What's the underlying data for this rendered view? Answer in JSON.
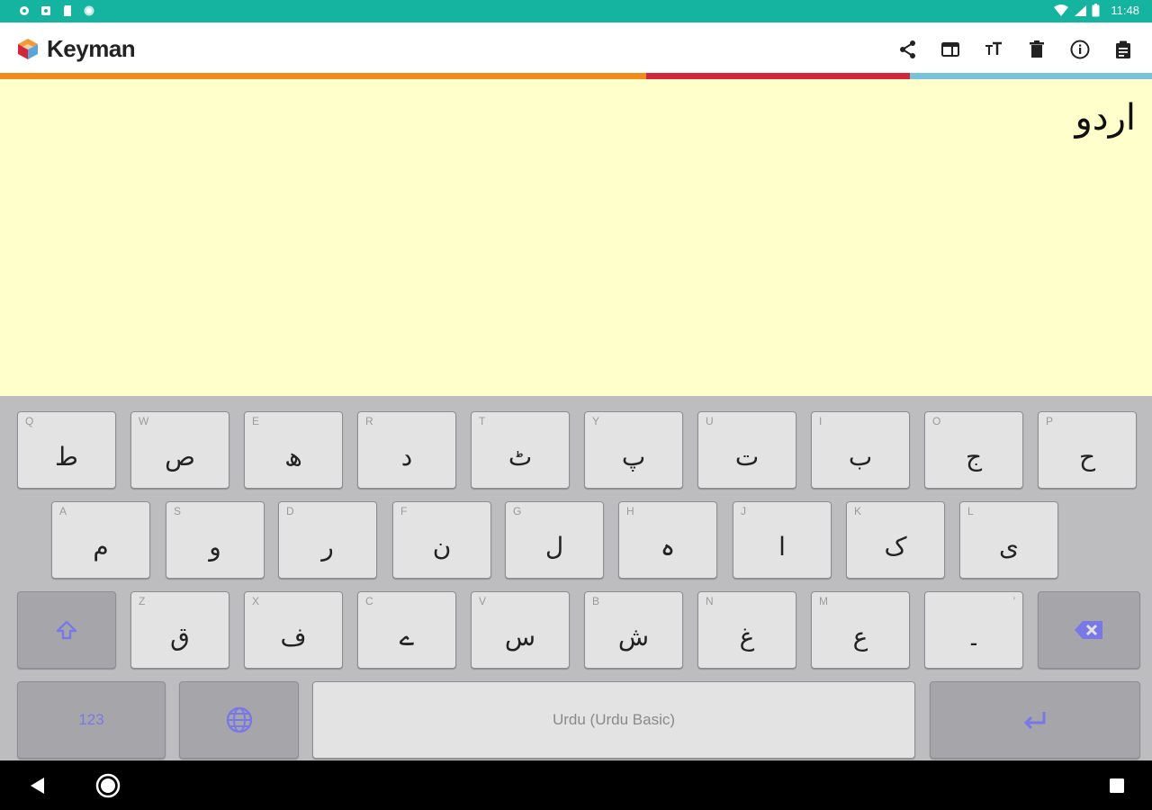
{
  "status_bar": {
    "time": "11:48",
    "left_icons": [
      "settings-icon",
      "app-notification-icon",
      "sd-card-icon",
      "sync-icon"
    ],
    "right_icons": [
      "wifi-icon",
      "signal-icon",
      "battery-icon"
    ]
  },
  "app_bar": {
    "title": "Keyman",
    "logo": "keyman-logo",
    "actions": [
      {
        "name": "share-icon",
        "label": "Share"
      },
      {
        "name": "browser-icon",
        "label": "Web browser"
      },
      {
        "name": "text-size-icon",
        "label": "Text size"
      },
      {
        "name": "delete-icon",
        "label": "Clear text"
      },
      {
        "name": "info-icon",
        "label": "Info"
      },
      {
        "name": "clipboard-icon",
        "label": "Copy"
      }
    ]
  },
  "colors": {
    "status_bar": "#14b4a0",
    "stripe_orange": "#f08a1a",
    "stripe_red": "#d2263a",
    "stripe_blue": "#78c3da",
    "text_area_bg": "#ffffcb",
    "keyboard_bg": "#bdbdc0",
    "key_bg": "#e3e3e3",
    "special_key_bg": "#a6a6aa",
    "key_accent": "#7878e6"
  },
  "text_area": {
    "content": "اردو"
  },
  "keyboard": {
    "row1": [
      {
        "hint": "Q",
        "glyph": "ط"
      },
      {
        "hint": "W",
        "glyph": "ص"
      },
      {
        "hint": "E",
        "glyph": "ھ"
      },
      {
        "hint": "R",
        "glyph": "د"
      },
      {
        "hint": "T",
        "glyph": "ٹ"
      },
      {
        "hint": "Y",
        "glyph": "پ"
      },
      {
        "hint": "U",
        "glyph": "ت"
      },
      {
        "hint": "I",
        "glyph": "ب"
      },
      {
        "hint": "O",
        "glyph": "ج"
      },
      {
        "hint": "P",
        "glyph": "ح"
      }
    ],
    "row2": [
      {
        "hint": "A",
        "glyph": "م"
      },
      {
        "hint": "S",
        "glyph": "و"
      },
      {
        "hint": "D",
        "glyph": "ر"
      },
      {
        "hint": "F",
        "glyph": "ن"
      },
      {
        "hint": "G",
        "glyph": "ل"
      },
      {
        "hint": "H",
        "glyph": "ہ"
      },
      {
        "hint": "J",
        "glyph": "ا"
      },
      {
        "hint": "K",
        "glyph": "ک"
      },
      {
        "hint": "L",
        "glyph": "ی"
      }
    ],
    "row3": [
      {
        "hint": "Z",
        "glyph": "ق"
      },
      {
        "hint": "X",
        "glyph": "ف"
      },
      {
        "hint": "C",
        "glyph": "ے"
      },
      {
        "hint": "V",
        "glyph": "س"
      },
      {
        "hint": "B",
        "glyph": "ش"
      },
      {
        "hint": "N",
        "glyph": "غ"
      },
      {
        "hint": "M",
        "glyph": "ع"
      },
      {
        "hint": "'",
        "glyph": "۔"
      }
    ],
    "shift_icon": "shift-icon",
    "backspace_icon": "backspace-icon",
    "numeric_label": "123",
    "globe_icon": "globe-icon",
    "spacebar_label": "Urdu (Urdu Basic)",
    "enter_icon": "enter-icon"
  },
  "nav_bar": {
    "buttons": [
      "back-icon",
      "home-icon",
      "recents-icon"
    ]
  }
}
